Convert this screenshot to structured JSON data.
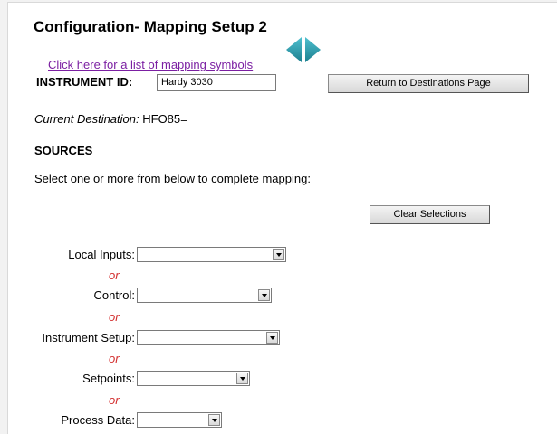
{
  "page": {
    "title": "Configuration- Mapping Setup 2",
    "symbols_link": "Click here for a list of mapping symbols",
    "nav": {
      "prev_icon": "left-triangle-arrow",
      "next_icon": "right-triangle-arrow",
      "arrow_color": "#2a8fa0"
    }
  },
  "instrument": {
    "label": "INSTRUMENT ID:",
    "value": "Hardy 3030"
  },
  "buttons": {
    "return_label": "Return to Destinations Page",
    "clear_label": "Clear Selections"
  },
  "destination": {
    "label": "Current Destination:",
    "value": " HFO85="
  },
  "sources": {
    "heading": "SOURCES",
    "instruction": "Select one or more from below to complete mapping:",
    "separator": "or",
    "fields": [
      {
        "label": "Local Inputs:",
        "value": ""
      },
      {
        "label": "Control:",
        "value": ""
      },
      {
        "label": "Instrument Setup:",
        "value": ""
      },
      {
        "label": "Setpoints:",
        "value": ""
      },
      {
        "label": "Process Data:",
        "value": ""
      }
    ]
  },
  "colors": {
    "link": "#7b1fa2",
    "separator": "#d32f2f",
    "background": "#ffffff"
  }
}
